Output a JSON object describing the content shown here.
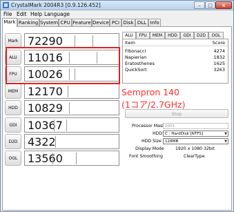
{
  "window": {
    "title": "CrystalMark 2004R3 [0.9.126.452]",
    "min": "–",
    "max": "□",
    "close": "×"
  },
  "menu": [
    "File",
    "Edit",
    "Help",
    "Language"
  ],
  "tabs": [
    "Mark",
    "Ranking",
    "System",
    "CPU",
    "Feature",
    "Device",
    "PCI",
    "Disk",
    "DLL",
    "Info"
  ],
  "scores": [
    {
      "label": "Mark",
      "value": "72290"
    },
    {
      "label": "ALU",
      "value": "11016"
    },
    {
      "label": "FPU",
      "value": "10026"
    },
    {
      "label": "MEM",
      "value": "12170"
    },
    {
      "label": "HDD",
      "value": "10829"
    },
    {
      "label": "GDI",
      "value": "10367"
    },
    {
      "label": "D2D",
      "value": "4322"
    },
    {
      "label": "OGL",
      "value": "13560"
    }
  ],
  "right_tabs": [
    "ALU",
    "FPU",
    "MEM",
    "HDD",
    "GDI",
    "D2D",
    "OGL"
  ],
  "list": {
    "col_item": "Item",
    "col_score": "Score",
    "rows": [
      {
        "name": "Fibonacci",
        "score": "4274"
      },
      {
        "name": "Napierian",
        "score": "1832"
      },
      {
        "name": "Eratosthenes",
        "score": "1625"
      },
      {
        "name": "QuickSort",
        "score": "3263"
      }
    ]
  },
  "annotation": {
    "line1": "Sempron 140",
    "line2": "(1コア/2.7GHz)",
    "color": "#ff2d2d"
  },
  "stop_label": "Stop",
  "settings": {
    "processor_mask_label": "Processor Mask",
    "processor_mask_value": "0001",
    "hdd_label": "HDD",
    "hdd_value": "C : HardDisk [NTFS]",
    "hdd_size_label": "HDD Size",
    "hdd_size_value": "128MB",
    "display_mode_label": "Display Mode",
    "display_mode_value": "1920 x 1080 32bit",
    "font_smoothing_label": "Font Smoothing",
    "font_smoothing_value": "ClearType"
  }
}
